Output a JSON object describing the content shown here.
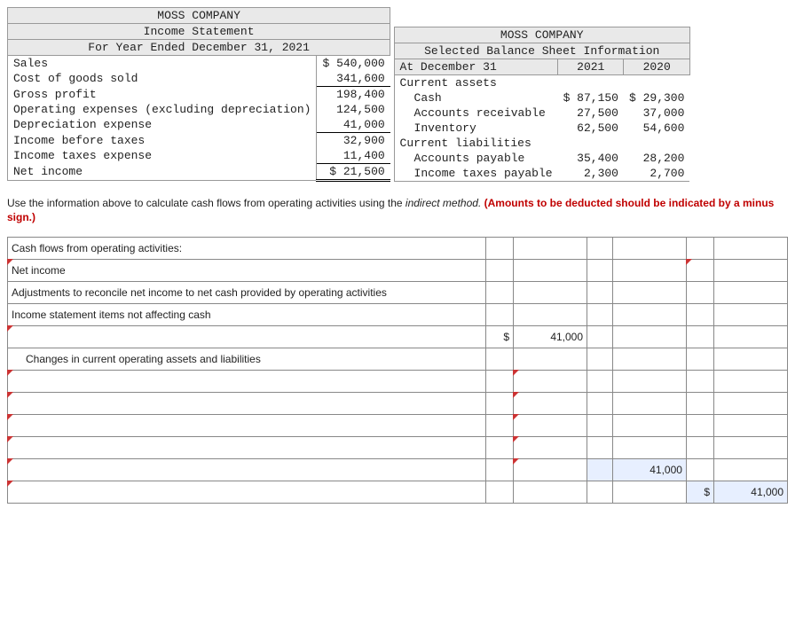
{
  "income_statement": {
    "company": "MOSS COMPANY",
    "title": "Income Statement",
    "period": "For Year Ended December 31, 2021",
    "rows": {
      "sales": {
        "label": "Sales",
        "value": "$ 540,000"
      },
      "cogs": {
        "label": "Cost of goods sold",
        "value": "341,600"
      },
      "gross_profit": {
        "label": "Gross profit",
        "value": "198,400"
      },
      "op_exp": {
        "label": "Operating expenses (excluding depreciation)",
        "value": "124,500"
      },
      "dep": {
        "label": "Depreciation expense",
        "value": "41,000"
      },
      "ibt": {
        "label": "Income before taxes",
        "value": "32,900"
      },
      "tax": {
        "label": "Income taxes expense",
        "value": "11,400"
      },
      "net": {
        "label": "Net income",
        "value": "$ 21,500"
      }
    }
  },
  "balance_sheet": {
    "company": "MOSS COMPANY",
    "title": "Selected Balance Sheet Information",
    "date_label": "At December 31",
    "col1": "2021",
    "col2": "2020",
    "current_assets_label": "Current assets",
    "cash": {
      "label": "Cash",
      "y1": "$ 87,150",
      "y0": "$ 29,300"
    },
    "ar": {
      "label": "Accounts receivable",
      "y1": "27,500",
      "y0": "37,000"
    },
    "inv": {
      "label": "Inventory",
      "y1": "62,500",
      "y0": "54,600"
    },
    "current_liab_label": "Current liabilities",
    "ap": {
      "label": "Accounts payable",
      "y1": "35,400",
      "y0": "28,200"
    },
    "itp": {
      "label": "Income taxes payable",
      "y1": "2,300",
      "y0": "2,700"
    }
  },
  "instructions": {
    "text_a": "Use the information above to calculate cash flows from operating activities using the ",
    "text_b": "indirect method.",
    "text_c": " (Amounts to be deducted should be indicated by a minus sign.)"
  },
  "worksheet": {
    "r1": "Cash flows from operating activities:",
    "r2": "Net income",
    "r3": "Adjustments to reconcile net income to net cash provided by operating activities",
    "r4": "Income statement items not affecting cash",
    "r5_sym": "$",
    "r5_val": "41,000",
    "r6": "Changes in current operating assets and liabilities",
    "sub1_val": "41,000",
    "total_sym": "$",
    "total_val": "41,000"
  }
}
